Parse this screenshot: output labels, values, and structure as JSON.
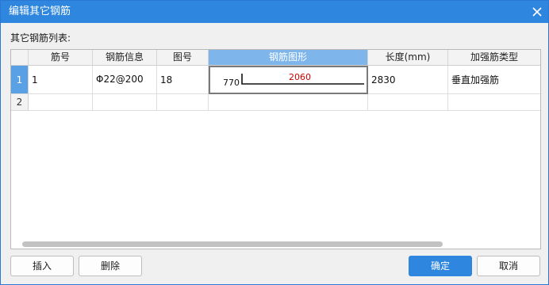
{
  "window": {
    "title": "编辑其它钢筋"
  },
  "list_label": "其它钢筋列表:",
  "columns": [
    "筋号",
    "钢筋信息",
    "图号",
    "钢筋图形",
    "长度(mm)",
    "加强筋类型"
  ],
  "rows": [
    {
      "index": "1",
      "bar_no": "1",
      "bar_info": "Φ22@200",
      "figure_no": "18",
      "shape": {
        "left_dim": "770",
        "top_dim": "2060"
      },
      "length": "2830",
      "reinforcement_type": "垂直加强筋"
    },
    {
      "index": "2",
      "bar_no": "",
      "bar_info": "",
      "figure_no": "",
      "shape": {
        "left_dim": "",
        "top_dim": ""
      },
      "length": "",
      "reinforcement_type": ""
    }
  ],
  "buttons": {
    "insert": "插入",
    "delete": "删除",
    "ok": "确定",
    "cancel": "取消"
  },
  "colors": {
    "titlebar": "#2e86de",
    "active_header": "#7eb6ec",
    "primary_button": "#2f86de",
    "dimension_red": "#cc0000"
  },
  "icons": {
    "close": "close-icon"
  }
}
